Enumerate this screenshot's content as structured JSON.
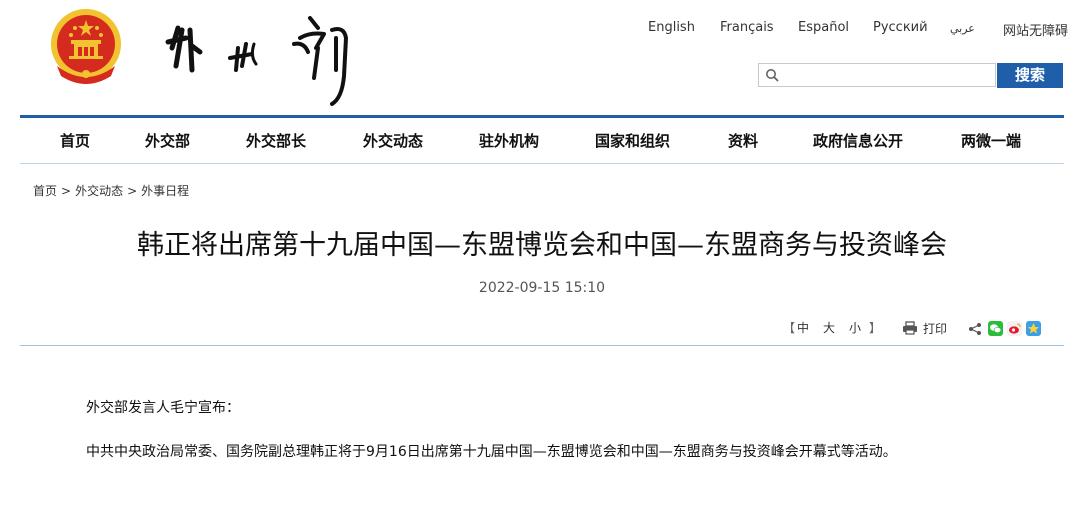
{
  "header": {
    "emblem_icon": "national-emblem-icon",
    "logo_text": "外交部",
    "languages": [
      "English",
      "Français",
      "Español",
      "Русский",
      "عربي",
      "网站无障碍"
    ],
    "search": {
      "placeholder": "",
      "value": "",
      "button_label": "搜索",
      "icon": "search-icon"
    }
  },
  "nav": {
    "items": [
      "首页",
      "外交部",
      "外交部长",
      "外交动态",
      "驻外机构",
      "国家和组织",
      "资料",
      "政府信息公开",
      "两微一端"
    ]
  },
  "breadcrumb": [
    "首页",
    "外交动态",
    "外事日程"
  ],
  "article": {
    "title": "韩正将出席第十九届中国—东盟博览会和中国—东盟商务与投资峰会",
    "date": "2022-09-15 15:10",
    "font_size_label": {
      "open": "【",
      "small": "中",
      "medium": "大",
      "large": "小",
      "close": "】"
    },
    "print_label": "打印",
    "share_icons": [
      "share-icon",
      "wechat-icon",
      "weibo-icon",
      "qzone-icon"
    ],
    "paragraphs": [
      "外交部发言人毛宁宣布：",
      "中共中央政治局常委、国务院副总理韩正将于9月16日出席第十九届中国—东盟博览会和中国—东盟商务与投资峰会开幕式等活动。"
    ]
  },
  "colors": {
    "brand_blue": "#1f5faa",
    "emblem_red": "#d52b1e",
    "emblem_gold": "#f2c230"
  }
}
